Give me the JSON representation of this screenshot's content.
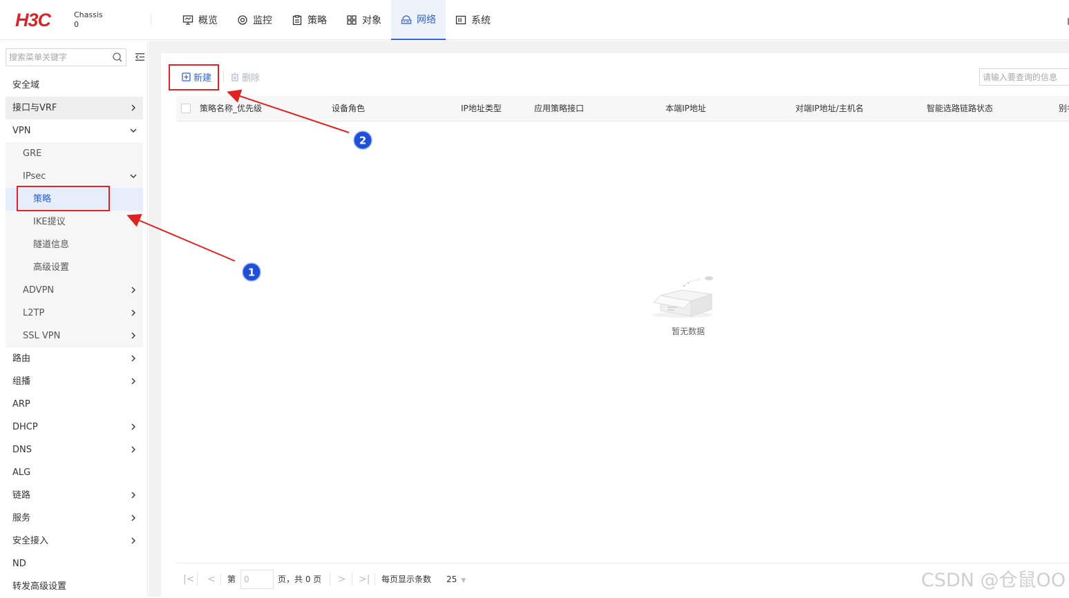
{
  "header": {
    "logo_text": "H3C",
    "chassis_line1": "Chassis",
    "chassis_line2": "0",
    "nav": [
      {
        "label": "概览",
        "icon": "monitor-icon"
      },
      {
        "label": "监控",
        "icon": "target-icon"
      },
      {
        "label": "策略",
        "icon": "clipboard-icon"
      },
      {
        "label": "对象",
        "icon": "grid-icon"
      },
      {
        "label": "网络",
        "icon": "network-icon",
        "active": true
      },
      {
        "label": "系统",
        "icon": "system-icon"
      }
    ]
  },
  "sidebar": {
    "search_placeholder": "搜索菜单关键字",
    "items": [
      {
        "label": "安全域",
        "level": 1
      },
      {
        "label": "接口与VRF",
        "level": 1,
        "chevron": "right"
      },
      {
        "label": "VPN",
        "level": 1,
        "chevron": "down"
      },
      {
        "label": "GRE",
        "level": 2
      },
      {
        "label": "IPsec",
        "level": 2,
        "chevron": "down"
      },
      {
        "label": "策略",
        "level": 3,
        "selected": true
      },
      {
        "label": "IKE提议",
        "level": 3
      },
      {
        "label": "隧道信息",
        "level": 3
      },
      {
        "label": "高级设置",
        "level": 3
      },
      {
        "label": "ADVPN",
        "level": 2,
        "chevron": "right"
      },
      {
        "label": "L2TP",
        "level": 2,
        "chevron": "right"
      },
      {
        "label": "SSL VPN",
        "level": 2,
        "chevron": "right"
      },
      {
        "label": "路由",
        "level": 1,
        "chevron": "right"
      },
      {
        "label": "组播",
        "level": 1,
        "chevron": "right"
      },
      {
        "label": "ARP",
        "level": 1
      },
      {
        "label": "DHCP",
        "level": 1,
        "chevron": "right"
      },
      {
        "label": "DNS",
        "level": 1,
        "chevron": "right"
      },
      {
        "label": "ALG",
        "level": 1
      },
      {
        "label": "链路",
        "level": 1,
        "chevron": "right"
      },
      {
        "label": "服务",
        "level": 1,
        "chevron": "right"
      },
      {
        "label": "安全接入",
        "level": 1,
        "chevron": "right"
      },
      {
        "label": "ND",
        "level": 1
      },
      {
        "label": "转发高级设置",
        "level": 1
      }
    ]
  },
  "toolbar": {
    "new_label": "新建",
    "delete_label": "删除",
    "query_placeholder": "请输入要查询的信息"
  },
  "table": {
    "columns": [
      "策略名称_优先级",
      "设备角色",
      "IP地址类型",
      "应用策略接口",
      "本端IP地址",
      "对端IP地址/主机名",
      "智能选路链路状态",
      "别名"
    ],
    "rows": [],
    "empty_text": "暂无数据"
  },
  "pager": {
    "first": "|<",
    "prev": "<",
    "page_prefix": "第",
    "page_value": "0",
    "page_suffix": "页，共 0 页",
    "next": ">",
    "last": ">|",
    "per_page_label": "每页显示条数",
    "per_page_value": "25"
  },
  "annotations": {
    "badge1": "1",
    "badge2": "2",
    "color": "#e02222"
  },
  "watermark": "CSDN @仓鼠OO",
  "colors": {
    "accent": "#2f63d6",
    "brand": "#d7262b",
    "annotation_red": "#e02222"
  }
}
